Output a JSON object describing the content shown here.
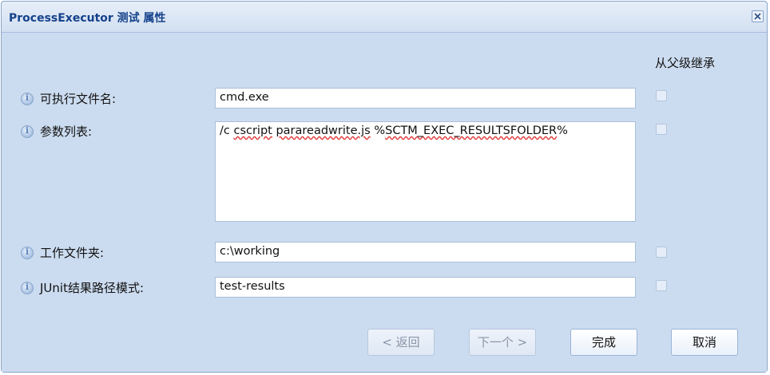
{
  "dialog": {
    "title": "ProcessExecutor 测试 属性",
    "close_icon": "close-icon"
  },
  "inherit_header": "从父级继承",
  "rows": [
    {
      "label": "可执行文件名:",
      "value": "cmd.exe",
      "inherit_checked": false
    },
    {
      "label": "参数列表:",
      "value": "/c cscript parareadwrite.js %SCTM_EXEC_RESULTSFOLDER%",
      "inherit_checked": false
    },
    {
      "label": "工作文件夹:",
      "value": "c:\\working",
      "inherit_checked": false
    },
    {
      "label": "JUnit结果路径模式:",
      "value": "test-results",
      "inherit_checked": false
    }
  ],
  "buttons": {
    "back": {
      "label": "< 返回",
      "enabled": false
    },
    "next": {
      "label": "下一个 >",
      "enabled": false
    },
    "finish": {
      "label": "完成",
      "enabled": true
    },
    "cancel": {
      "label": "取消",
      "enabled": true
    }
  },
  "icons": {
    "info": "info-icon"
  },
  "colors": {
    "title_text": "#15428b",
    "body_bg": "#ccdcf0",
    "spellcheck": "#e23d3d"
  }
}
